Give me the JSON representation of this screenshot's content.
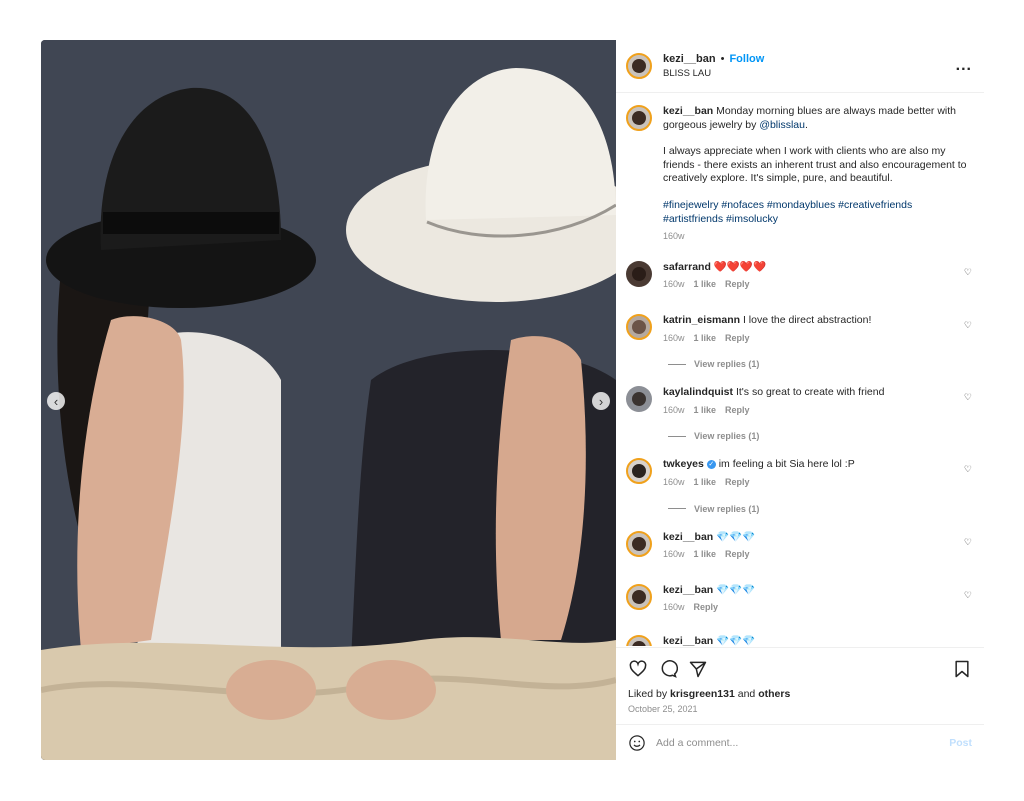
{
  "header": {
    "username": "kezi__ban",
    "separator": "•",
    "follow_label": "Follow",
    "location": "BLISS LAU",
    "more_label": "..."
  },
  "caption": {
    "username": "kezi__ban",
    "p1_text": "Monday morning blues are always made better with gorgeous jewelry by ",
    "p1_mention": "@blisslau",
    "p1_end": ".",
    "p2": "I always appreciate when I work with clients who are also my friends - there exists an inherent trust and also encouragement to creatively explore. It's simple, pure, and beautiful.",
    "hashtags": "#finejewelry #nofaces #mondayblues #creativefriends #artistfriends #imsolucky",
    "time": "160w"
  },
  "comments": [
    {
      "username": "safarrand",
      "text": "❤️❤️❤️❤️",
      "time": "160w",
      "likes": "1 like",
      "reply": "Reply",
      "view_replies": ""
    },
    {
      "username": "katrin_eismann",
      "text": "I love the direct abstraction!",
      "time": "160w",
      "likes": "1 like",
      "reply": "Reply",
      "view_replies": "View replies (1)"
    },
    {
      "username": "kaylalindquist",
      "text": "It's so great to create with friend",
      "time": "160w",
      "likes": "1 like",
      "reply": "Reply",
      "view_replies": "View replies (1)"
    },
    {
      "username": "twkeyes",
      "text": "im feeling a bit Sia here lol :P",
      "time": "160w",
      "likes": "1 like",
      "reply": "Reply",
      "view_replies": "View replies (1)"
    },
    {
      "username": "kezi__ban",
      "text": "💎💎💎",
      "time": "160w",
      "likes": "1 like",
      "reply": "Reply",
      "view_replies": ""
    },
    {
      "username": "kezi__ban",
      "text": "💎💎💎",
      "time": "160w",
      "likes": "",
      "reply": "Reply",
      "view_replies": ""
    },
    {
      "username": "kezi__ban",
      "text": "💎💎💎",
      "time": "",
      "likes": "",
      "reply": "",
      "view_replies": ""
    }
  ],
  "actions": {
    "liked_by_prefix": "Liked by ",
    "liked_by_user": "krisgreen131",
    "liked_by_mid": " and ",
    "liked_by_others": "others",
    "date": "October 25, 2021"
  },
  "add_comment": {
    "placeholder": "Add a comment...",
    "post_label": "Post"
  },
  "colors": {
    "accent": "#0095f6",
    "story_ring": "#f0a11c",
    "verified": "#3897f0"
  }
}
